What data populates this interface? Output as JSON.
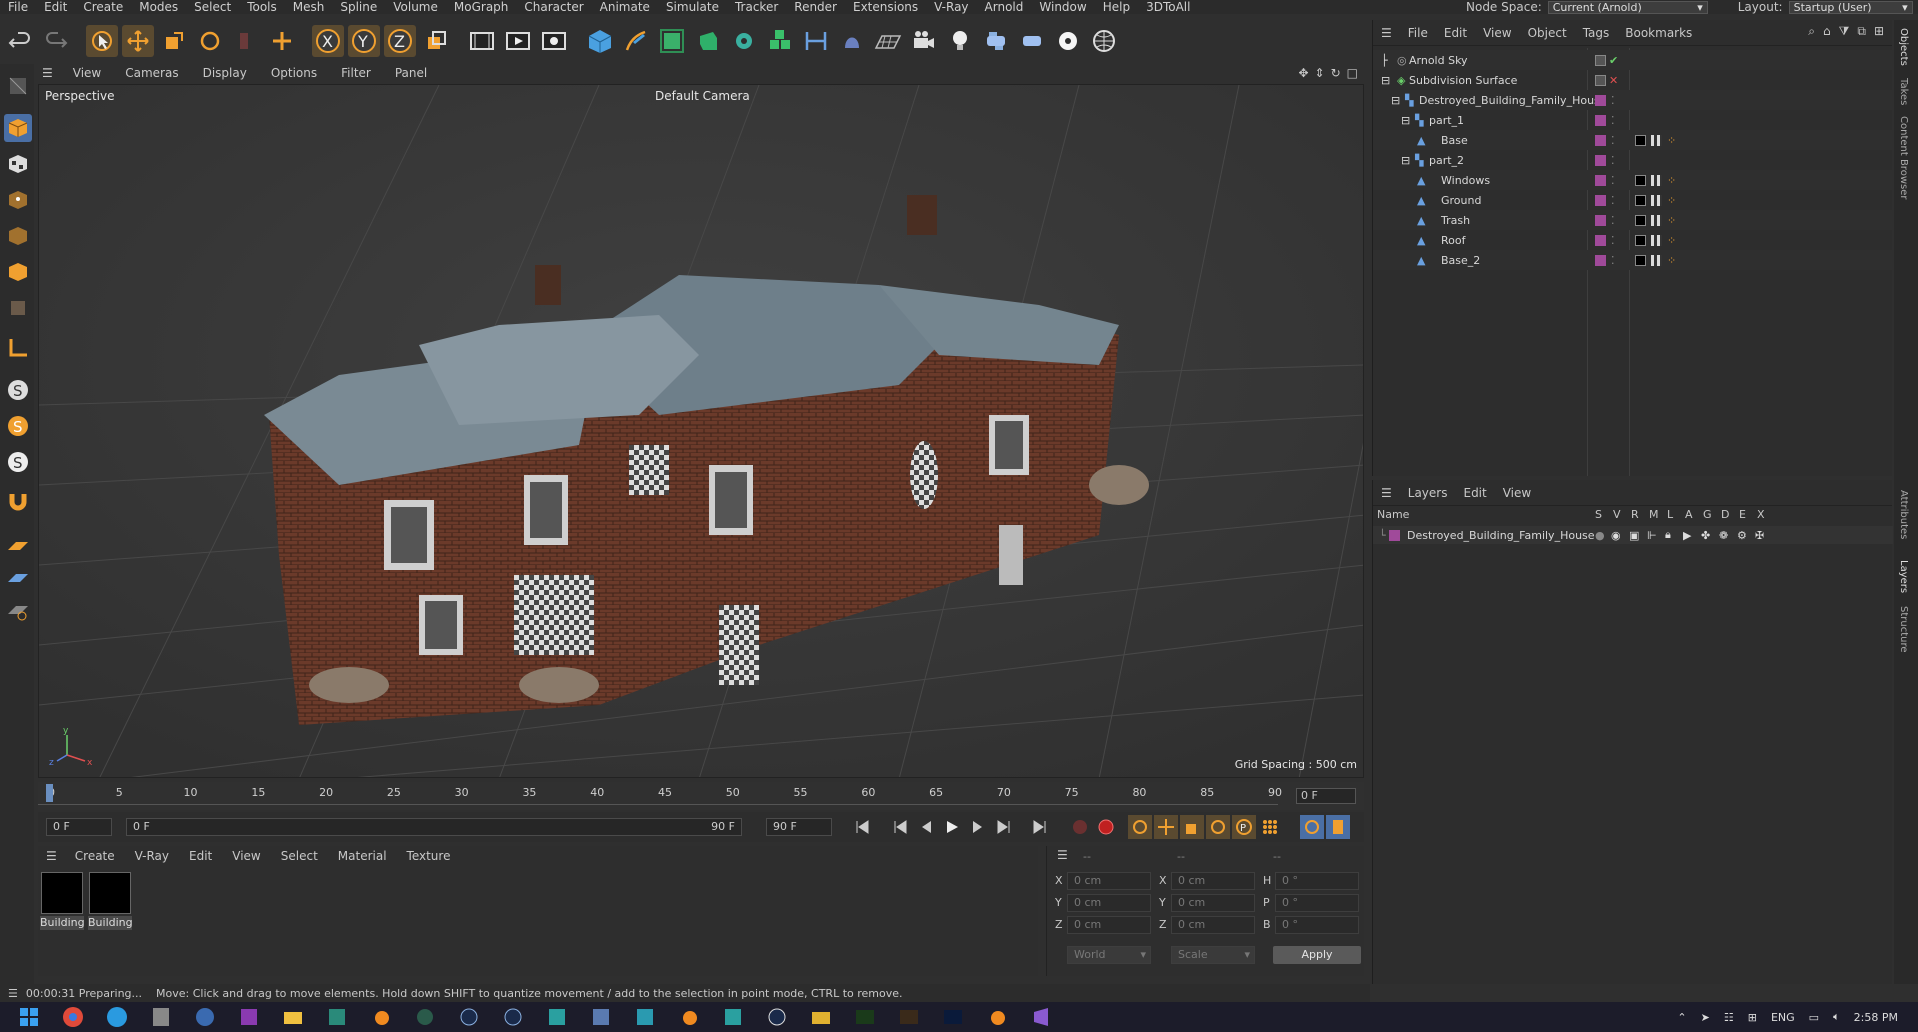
{
  "menubar": {
    "items": [
      "File",
      "Edit",
      "Create",
      "Modes",
      "Select",
      "Tools",
      "Mesh",
      "Spline",
      "Volume",
      "MoGraph",
      "Character",
      "Animate",
      "Simulate",
      "Tracker",
      "Render",
      "Extensions",
      "V-Ray",
      "Arnold",
      "Window",
      "Help",
      "3DToAll"
    ]
  },
  "nodespace": {
    "label": "Node Space:",
    "value": "Current (Arnold)",
    "layout_label": "Layout:",
    "layout_value": "Startup (User)"
  },
  "viewport": {
    "menu": [
      "View",
      "Cameras",
      "Display",
      "Options",
      "Filter",
      "Panel"
    ],
    "view_name": "Perspective",
    "camera": "Default Camera",
    "grid_spacing": "Grid Spacing : 500 cm"
  },
  "timeline": {
    "ticks": [
      "0",
      "5",
      "10",
      "15",
      "20",
      "25",
      "30",
      "35",
      "40",
      "45",
      "50",
      "55",
      "60",
      "65",
      "70",
      "75",
      "80",
      "85",
      "90"
    ],
    "current_frame": "0 F"
  },
  "controls": {
    "start": "0 F",
    "cur": "0 F",
    "end_slider": "90 F",
    "end": "90 F"
  },
  "materials": {
    "menu": [
      "Create",
      "V-Ray",
      "Edit",
      "View",
      "Select",
      "Material",
      "Texture"
    ],
    "items": [
      {
        "name": "Building"
      },
      {
        "name": "Building"
      }
    ]
  },
  "coords": {
    "headers": [
      "--",
      "--",
      "--"
    ],
    "rows": [
      {
        "a": "X",
        "av": "0 cm",
        "b": "X",
        "bv": "0 cm",
        "c": "H",
        "cv": "0 °"
      },
      {
        "a": "Y",
        "av": "0 cm",
        "b": "Y",
        "bv": "0 cm",
        "c": "P",
        "cv": "0 °"
      },
      {
        "a": "Z",
        "av": "0 cm",
        "b": "Z",
        "bv": "0 cm",
        "c": "B",
        "cv": "0 °"
      }
    ],
    "mode1": "World",
    "mode2": "Scale",
    "apply": "Apply"
  },
  "status": {
    "time": "00:00:31 Preparing...",
    "hint": "Move: Click and drag to move elements. Hold down SHIFT to quantize movement / add to the selection in point mode, CTRL to remove."
  },
  "objects": {
    "menu": [
      "File",
      "Edit",
      "View",
      "Object",
      "Tags",
      "Bookmarks"
    ],
    "rows": [
      {
        "name": "Arnold Sky"
      },
      {
        "name": "Subdivision Surface"
      },
      {
        "name": "Destroyed_Building_Family_House"
      },
      {
        "name": "part_1"
      },
      {
        "name": "Base"
      },
      {
        "name": "part_2"
      },
      {
        "name": "Windows"
      },
      {
        "name": "Ground"
      },
      {
        "name": "Trash"
      },
      {
        "name": "Roof"
      },
      {
        "name": "Base_2"
      }
    ]
  },
  "layers": {
    "menu": [
      "Layers",
      "Edit",
      "View"
    ],
    "col_name": "Name",
    "cols": [
      "S",
      "V",
      "R",
      "M",
      "L",
      "A",
      "G",
      "D",
      "E",
      "X"
    ],
    "rows": [
      {
        "name": "Destroyed_Building_Family_House"
      }
    ]
  },
  "sidetabs": [
    "Objects",
    "Takes",
    "Content Browser",
    "Attributes",
    "Layers",
    "Structure"
  ],
  "tray": {
    "lang": "ENG",
    "time": "2:58 PM"
  },
  "colors": {
    "accent": "#f0a030",
    "layer": "#a04a9a",
    "selected_blue": "#4a6fa5"
  }
}
